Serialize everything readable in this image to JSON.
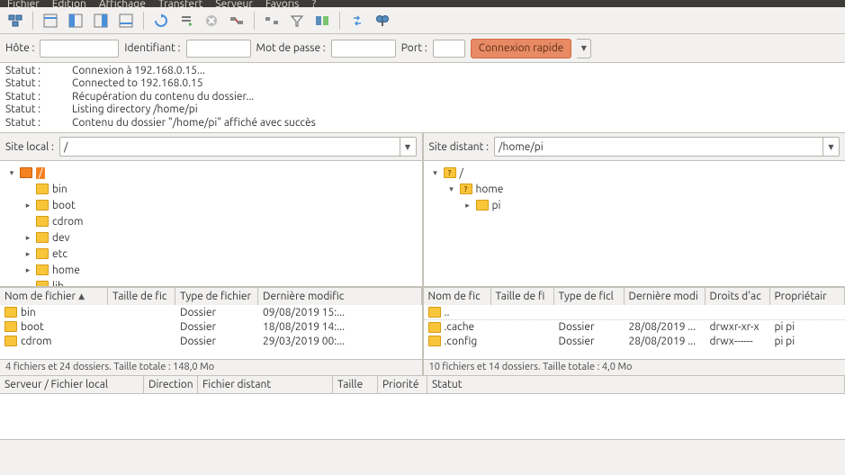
{
  "menu": {
    "items": [
      "Fichier",
      "Édition",
      "Affichage",
      "Transfert",
      "Serveur",
      "Favoris",
      "?"
    ]
  },
  "conn": {
    "host_label": "Hôte :",
    "user_label": "Identifiant :",
    "pass_label": "Mot de passe :",
    "port_label": "Port :",
    "quick_label": "Connexion rapide"
  },
  "log": [
    {
      "k": "Statut :",
      "v": "Connexion à 192.168.0.15..."
    },
    {
      "k": "Statut :",
      "v": "Connected to 192.168.0.15"
    },
    {
      "k": "Statut :",
      "v": "Récupération du contenu du dossier..."
    },
    {
      "k": "Statut :",
      "v": "Listing directory /home/pi"
    },
    {
      "k": "Statut :",
      "v": "Contenu du dossier \"/home/pi\" affiché avec succès"
    }
  ],
  "local": {
    "label": "Site local :",
    "path": "/",
    "tree": [
      {
        "indent": 0,
        "twist": "▾",
        "icon": "orange",
        "name": "/",
        "sel": true
      },
      {
        "indent": 1,
        "twist": "",
        "icon": "f",
        "name": "bin"
      },
      {
        "indent": 1,
        "twist": "▸",
        "icon": "f",
        "name": "boot"
      },
      {
        "indent": 1,
        "twist": "",
        "icon": "f",
        "name": "cdrom"
      },
      {
        "indent": 1,
        "twist": "▸",
        "icon": "f",
        "name": "dev"
      },
      {
        "indent": 1,
        "twist": "▸",
        "icon": "f",
        "name": "etc"
      },
      {
        "indent": 1,
        "twist": "▸",
        "icon": "f",
        "name": "home"
      },
      {
        "indent": 1,
        "twist": "",
        "icon": "f",
        "name": "lib"
      }
    ],
    "cols": [
      "Nom de fichier",
      "Taille de fic",
      "Type de fichier",
      "Dernière modific"
    ],
    "rows": [
      {
        "name": "bin",
        "size": "",
        "type": "Dossier",
        "mod": "09/08/2019 15:..."
      },
      {
        "name": "boot",
        "size": "",
        "type": "Dossier",
        "mod": "18/08/2019 14:..."
      },
      {
        "name": "cdrom",
        "size": "",
        "type": "Dossier",
        "mod": "29/03/2019 00:..."
      }
    ],
    "status": "4 fichiers et 24 dossiers. Taille totale : 148,0 Mo"
  },
  "remote": {
    "label": "Site distant :",
    "path": "/home/pi",
    "tree": [
      {
        "indent": 0,
        "twist": "▾",
        "icon": "q",
        "name": "/"
      },
      {
        "indent": 1,
        "twist": "▾",
        "icon": "q",
        "name": "home"
      },
      {
        "indent": 2,
        "twist": "▸",
        "icon": "f",
        "name": "pi"
      }
    ],
    "cols": [
      "Nom de fic",
      "Taille de fi",
      "Type de ficl",
      "Dernière modi",
      "Droits d'ac",
      "Propriétair"
    ],
    "rows": [
      {
        "name": "..",
        "size": "",
        "type": "",
        "mod": "",
        "perm": "",
        "own": ""
      },
      {
        "name": ".cache",
        "size": "",
        "type": "Dossier",
        "mod": "28/08/2019 ...",
        "perm": "drwxr-xr-x",
        "own": "pi pi"
      },
      {
        "name": ".config",
        "size": "",
        "type": "Dossier",
        "mod": "28/08/2019 ...",
        "perm": "drwx------",
        "own": "pi pi"
      }
    ],
    "status": "10 fichiers et 14 dossiers. Taille totale : 4,0 Mo"
  },
  "queue": {
    "cols": [
      "Serveur / Fichier local",
      "Direction",
      "Fichier distant",
      "Taille",
      "Priorité",
      "Statut"
    ]
  }
}
